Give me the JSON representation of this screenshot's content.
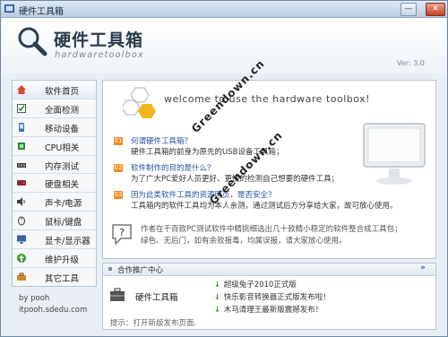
{
  "window": {
    "title": "硬件工具箱",
    "min_glyph": "—",
    "close_glyph": "✕"
  },
  "header": {
    "title": "硬件工具箱",
    "subtitle": "hardwaretoolbox",
    "version": "Ver: 3.0"
  },
  "sidebar": {
    "items": [
      {
        "label": "软件首页",
        "icon": "home-icon"
      },
      {
        "label": "全面检测",
        "icon": "checklist-icon"
      },
      {
        "label": "移动设备",
        "icon": "usb-device-icon"
      },
      {
        "label": "CPU相关",
        "icon": "cpu-icon"
      },
      {
        "label": "内存测试",
        "icon": "memory-icon"
      },
      {
        "label": "硬盘相关",
        "icon": "harddisk-icon"
      },
      {
        "label": "声卡/电源",
        "icon": "speaker-icon"
      },
      {
        "label": "鼠标/键盘",
        "icon": "mouse-icon"
      },
      {
        "label": "显卡/显示器",
        "icon": "monitor-icon"
      },
      {
        "label": "维护升级",
        "icon": "upgrade-icon"
      },
      {
        "label": "其它工具",
        "icon": "tools-icon"
      }
    ],
    "byline_1": "by pooh",
    "byline_2": "itpooh.sdedu.com"
  },
  "main": {
    "welcome": "welcome to use the hardware toolbox!",
    "qa": [
      {
        "num": "01",
        "q": "何谓硬件工具箱？",
        "a": "硬件工具箱的前身为原先的USB设备工具箱；"
      },
      {
        "num": "02",
        "q": "软件制作的目的是什么？",
        "a": "为了广大PC爱好人员更好、更快的检测自己想要的硬件工具；"
      },
      {
        "num": "03",
        "q": "因为此类软件工具的资源网页，是否安全？",
        "a": "工具箱内的软件工具均为本人亲测，通过测试后方分享给大家，故可放心使用。"
      }
    ],
    "note_1": "作者在千百款PC测试软件中精挑细选出几十款精小稳定的软件整合成工具包；",
    "note_2": "绿色、无后门，如有余款报毒，均属误报，请大家放心使用。"
  },
  "promo": {
    "header": "合作推广中心",
    "more": "»",
    "product": "硬件工具箱",
    "links": [
      "超级兔子2010正式版",
      "快乐影音转换器正式版发布啦！",
      "木马清理王最新版震撼发布！"
    ],
    "hint": "提示：打开新版发布页面."
  },
  "watermark": "Greendown.cn",
  "colors": {
    "accent": "#2d62b8",
    "badge": "#f08a1c",
    "link_arrow": "#3a9a2c"
  }
}
